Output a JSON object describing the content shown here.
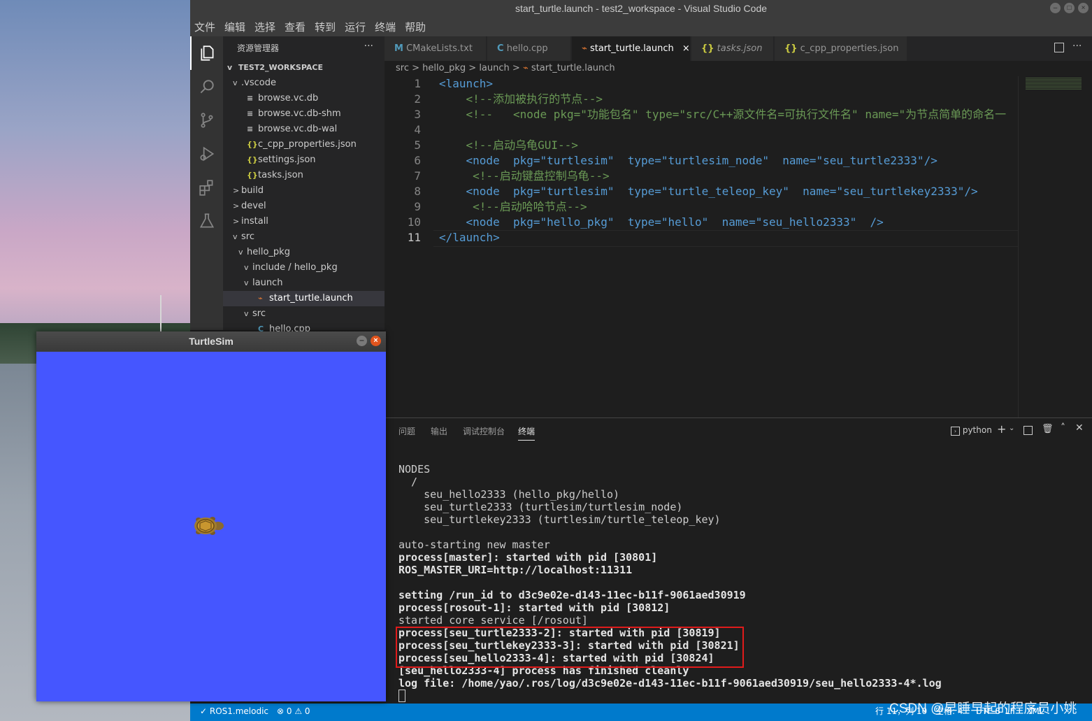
{
  "window": {
    "title": "start_turtle.launch - test2_workspace - Visual Studio Code",
    "menu": [
      "文件",
      "编辑",
      "选择",
      "查看",
      "转到",
      "运行",
      "终端",
      "帮助"
    ]
  },
  "sidebar": {
    "header": "资源管理器",
    "more": "···",
    "workspace": "TEST2_WORKSPACE",
    "tree": [
      {
        "label": ".vscode",
        "chev": "v",
        "icon": ""
      },
      {
        "label": "browse.vc.db",
        "chev": "",
        "icon": "≡"
      },
      {
        "label": "browse.vc.db-shm",
        "chev": "",
        "icon": "≡"
      },
      {
        "label": "browse.vc.db-wal",
        "chev": "",
        "icon": "≡"
      },
      {
        "label": "c_cpp_properties.json",
        "chev": "",
        "icon": "{}"
      },
      {
        "label": "settings.json",
        "chev": "",
        "icon": "{}"
      },
      {
        "label": "tasks.json",
        "chev": "",
        "icon": "{}"
      },
      {
        "label": "build",
        "chev": ">",
        "icon": ""
      },
      {
        "label": "devel",
        "chev": ">",
        "icon": ""
      },
      {
        "label": "install",
        "chev": ">",
        "icon": ""
      },
      {
        "label": "src",
        "chev": "v",
        "icon": ""
      },
      {
        "label": "hello_pkg",
        "chev": "v",
        "icon": ""
      },
      {
        "label": "include / hello_pkg",
        "chev": "v",
        "icon": ""
      },
      {
        "label": "launch",
        "chev": "v",
        "icon": ""
      },
      {
        "label": "start_turtle.launch",
        "chev": "",
        "icon": "rss"
      },
      {
        "label": "src",
        "chev": "v",
        "icon": ""
      },
      {
        "label": "hello.cpp",
        "chev": "",
        "icon": "c"
      }
    ]
  },
  "tabs": [
    {
      "label": "CMakeLists.txt",
      "icon": "M"
    },
    {
      "label": "hello.cpp",
      "icon": "C"
    },
    {
      "label": "start_turtle.launch",
      "icon": "rss",
      "close": "×"
    },
    {
      "label": "tasks.json",
      "icon": "{}"
    },
    {
      "label": "c_cpp_properties.json",
      "icon": "{}"
    }
  ],
  "breadcrumb": {
    "parts": [
      "src",
      "hello_pkg",
      "launch",
      "start_turtle.launch"
    ],
    "sep": ">"
  },
  "editor": {
    "line_numbers": [
      "1",
      "2",
      "3",
      "4",
      "5",
      "6",
      "7",
      "8",
      "9",
      "10",
      "11"
    ],
    "lines": [
      "<launch>",
      "    <!--添加被执行的节点-->",
      "    <!--   <node pkg=\"功能包名\" type=\"src/C++源文件名=可执行文件名\" name=\"为节点简单的命名一",
      "",
      "    <!--启动乌龟GUI-->",
      "    <node  pkg=\"turtlesim\"  type=\"turtlesim_node\"  name=\"seu_turtle2333\"/>",
      "     <!--启动键盘控制乌龟-->",
      "    <node  pkg=\"turtlesim\"  type=\"turtle_teleop_key\"  name=\"seu_turtlekey2333\"/>",
      "     <!--启动哈哈节点-->",
      "    <node  pkg=\"hello_pkg\"  type=\"hello\"  name=\"seu_hello2333\"  />",
      "</launch>"
    ]
  },
  "panel": {
    "tabs": [
      "问题",
      "输出",
      "调试控制台",
      "终端"
    ],
    "shell": "python",
    "terminal": [
      {
        "text": "NODES",
        "bold": false
      },
      {
        "text": "  /",
        "bold": false
      },
      {
        "text": "    seu_hello2333 (hello_pkg/hello)",
        "bold": false
      },
      {
        "text": "    seu_turtle2333 (turtlesim/turtlesim_node)",
        "bold": false
      },
      {
        "text": "    seu_turtlekey2333 (turtlesim/turtle_teleop_key)",
        "bold": false
      },
      {
        "text": "",
        "bold": false
      },
      {
        "text": "auto-starting new master",
        "bold": false
      },
      {
        "text": "process[master]: started with pid [30801]",
        "bold": true
      },
      {
        "text": "ROS_MASTER_URI=http://localhost:11311",
        "bold": true
      },
      {
        "text": "",
        "bold": false
      },
      {
        "text": "setting /run_id to d3c9e02e-d143-11ec-b11f-9061aed30919",
        "bold": true
      },
      {
        "text": "process[rosout-1]: started with pid [30812]",
        "bold": true
      },
      {
        "text": "started core service [/rosout]",
        "bold": false
      },
      {
        "text": "process[seu_turtle2333-2]: started with pid [30819]",
        "bold": true
      },
      {
        "text": "process[seu_turtlekey2333-3]: started with pid [30821]",
        "bold": true
      },
      {
        "text": "process[seu_hello2333-4]: started with pid [30824]",
        "bold": true
      },
      {
        "text": "[seu_hello2333-4] process has finished cleanly",
        "bold": true
      },
      {
        "text": "log file: /home/yao/.ros/log/d3c9e02e-d143-11ec-b11f-9061aed30919/seu_hello2333-4*.log",
        "bold": true
      }
    ]
  },
  "status": {
    "ros": "✓ ROS1.melodic",
    "errors": "⊗ 0 ⚠ 0",
    "position": "行 11，列 10",
    "spaces": "空格: 4",
    "encoding": "UTF-8",
    "eol": "LF",
    "lang": "XML"
  },
  "turtlesim": {
    "title": "TurtleSim",
    "bg_color": "#4556ff"
  },
  "watermark": "CSDN @早睡早起的程序员小姚"
}
